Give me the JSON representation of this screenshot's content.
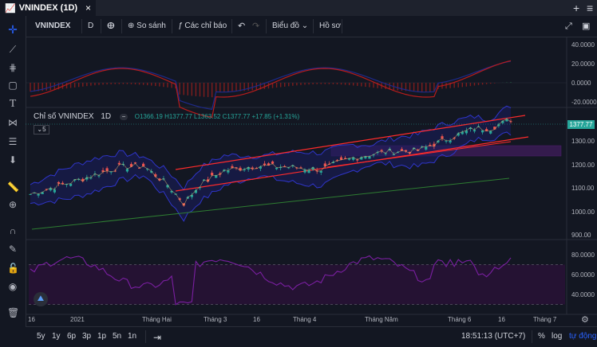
{
  "window": {
    "tab_title": "VNINDEX (1D)",
    "close_glyph": "×",
    "add_glyph": "+",
    "menu_glyph": "≡"
  },
  "toolbar": {
    "symbol": "VNINDEX",
    "interval": "D",
    "compare": "So sánh",
    "indicators": "Các chỉ báo",
    "chart_type": "Biểu đồ",
    "profile": "Hồ sơ"
  },
  "legend": {
    "name": "Chỉ số VNINDEX",
    "interval": "1D",
    "ohlc": "O1366.19  H1377.77  L1363.52  C1377.77  +17.85 (+1.31%)",
    "indicator_count": "5"
  },
  "price_badge": "1377.77",
  "bottom": {
    "timeframes": [
      "5y",
      "1y",
      "6p",
      "3p",
      "1p",
      "5n",
      "1n"
    ],
    "clock": "18:51:13 (UTC+7)",
    "percent": "%",
    "log": "log",
    "auto": "tự động"
  },
  "colors": {
    "background": "#131722",
    "up": "#26a69a",
    "down": "#ef5350",
    "bollinger": "#2f35c9",
    "channel": "#ff2b2b",
    "rsi": "#7b1fa2",
    "ma_green": "#1b5e20"
  },
  "chart_data": [
    {
      "pane": "momentum",
      "type": "line",
      "y_ticks": [
        "40.0000",
        "20.0000",
        "0.0000",
        "-20.0000"
      ],
      "ylim": [
        -30,
        50
      ]
    },
    {
      "pane": "price",
      "type": "candlestick",
      "x_ticks": [
        "16",
        "2021",
        "Tháng Hai",
        "Tháng 3",
        "16",
        "Tháng 4",
        "Tháng Năm",
        "Tháng 6",
        "16",
        "Tháng 7"
      ],
      "y_ticks": [
        "1300.00",
        "1200.00",
        "1100.00",
        "1000.00",
        "900.00"
      ],
      "ylim": [
        870,
        1420
      ],
      "last_close": 1377.77
    },
    {
      "pane": "rsi",
      "type": "line",
      "y_ticks": [
        "80.0000",
        "60.0000",
        "40.0000"
      ],
      "ylim": [
        20,
        90
      ],
      "bands": [
        70,
        30
      ]
    }
  ]
}
